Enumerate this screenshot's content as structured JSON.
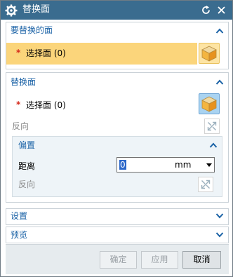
{
  "window": {
    "title": "替换面"
  },
  "section_faces_to_replace": {
    "title": "要替换的面",
    "select_label": "选择面 (0)",
    "required_marker": "*"
  },
  "section_replacement_face": {
    "title": "替换面",
    "select_label": "选择面 (0)",
    "required_marker": "*",
    "reverse_label": "反向"
  },
  "offset": {
    "title": "偏置",
    "distance_label": "距离",
    "distance_value": "0",
    "unit": "mm",
    "reverse_label": "反向"
  },
  "settings": {
    "title": "设置"
  },
  "preview": {
    "title": "预览"
  },
  "buttons": {
    "ok": "确定",
    "apply": "应用",
    "cancel": "取消"
  },
  "colors": {
    "titlebar": "#3a6c8f",
    "section_title": "#1a62a6",
    "highlight": "#fbd57b"
  }
}
